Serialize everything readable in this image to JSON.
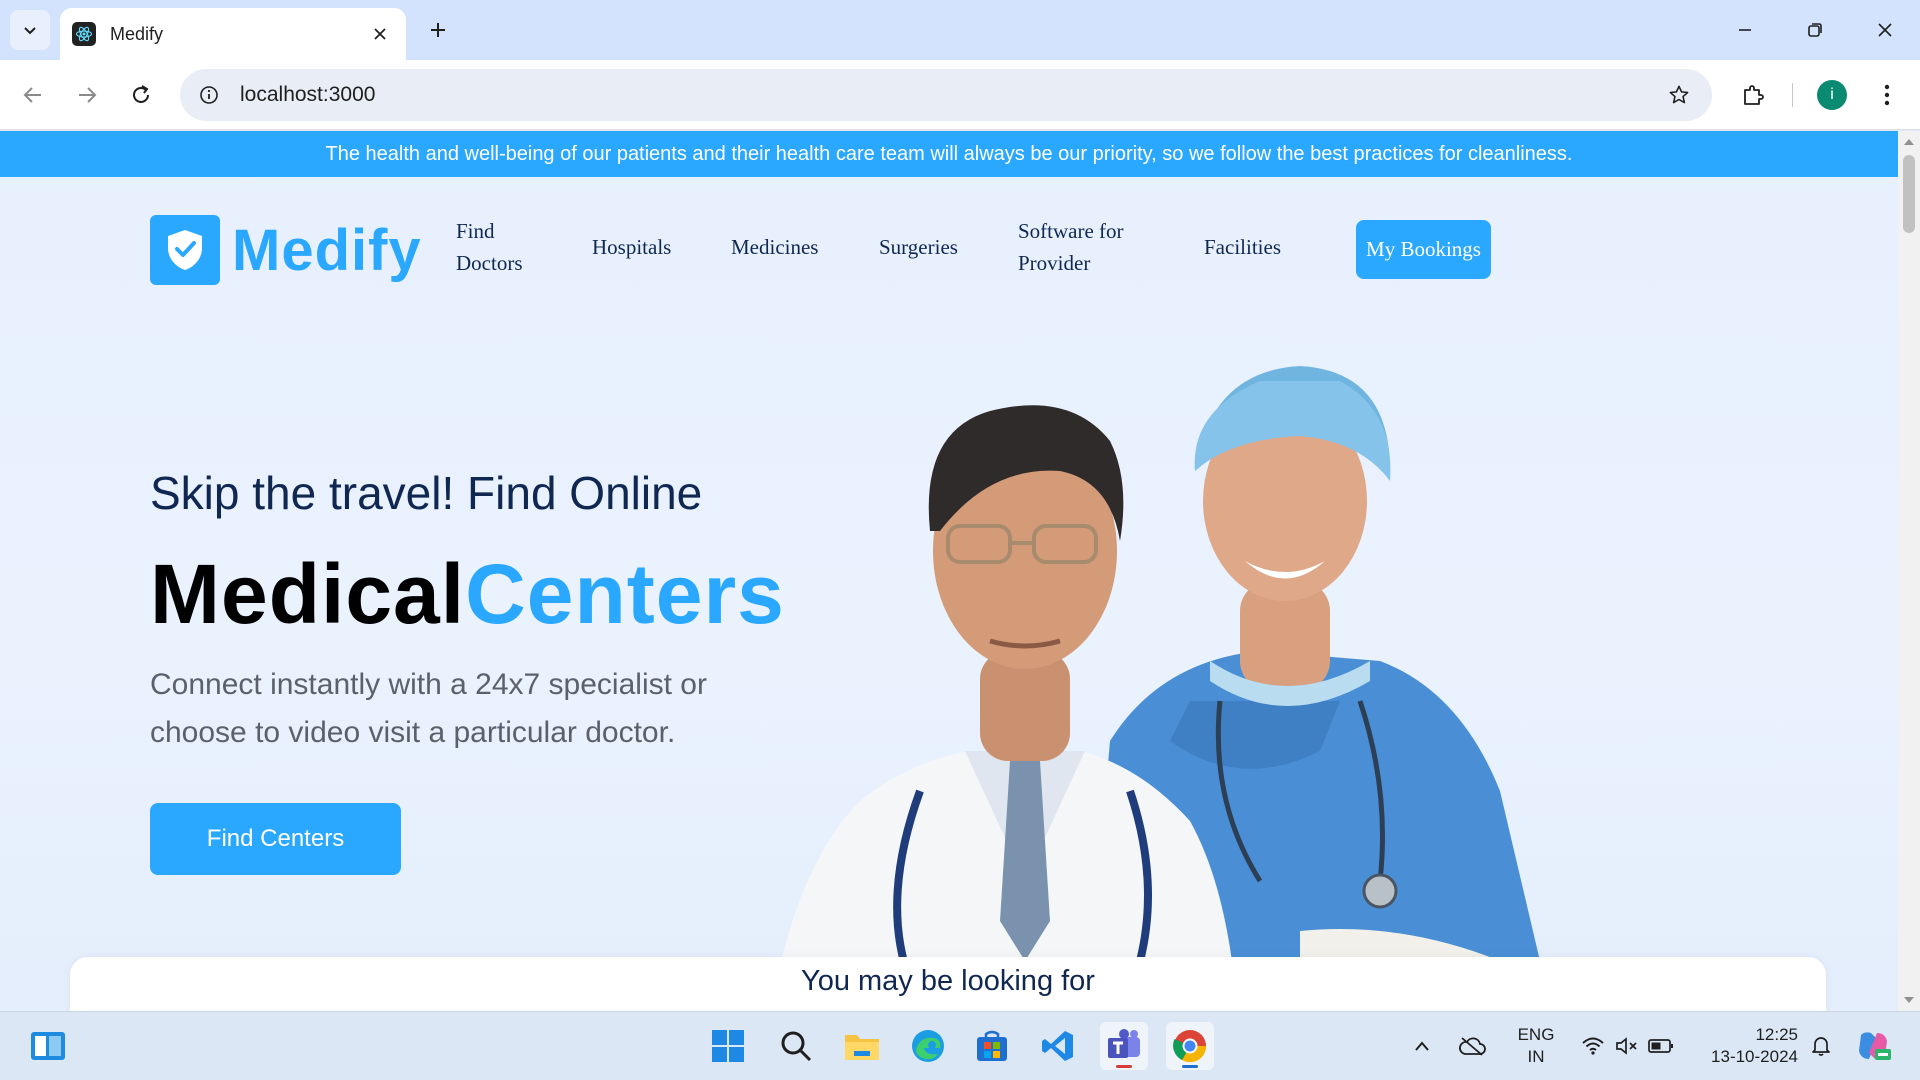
{
  "browser": {
    "tab_title": "Medify",
    "url": "localhost:3000",
    "profile_initial": "i"
  },
  "page": {
    "announcement": "The health and well-being of our patients and their health care team will always be our priority, so we follow the best practices for cleanliness.",
    "logo_text": "Medify",
    "nav": {
      "find_doctors_line1": "Find",
      "find_doctors_line2": "Doctors",
      "hospitals": "Hospitals",
      "medicines": "Medicines",
      "surgeries": "Surgeries",
      "software_line1": "Software for",
      "software_line2": "Provider",
      "facilities": "Facilities",
      "my_bookings": "My Bookings"
    },
    "hero": {
      "subtitle": "Skip the travel! Find Online",
      "title_part1": "Medical",
      "title_part2": "Centers",
      "description": "Connect instantly with a 24x7 specialist or choose to video visit a particular doctor.",
      "button": "Find Centers"
    },
    "section_heading": "You may be looking for",
    "brand_color": "#2aa7ff"
  },
  "taskbar": {
    "lang_line1": "ENG",
    "lang_line2": "IN",
    "time": "12:25",
    "date": "13-10-2024",
    "icons": [
      "widgets-icon",
      "windows-start-icon",
      "search-icon",
      "file-explorer-icon",
      "edge-icon",
      "store-icon",
      "vscode-icon",
      "teams-icon",
      "chrome-icon"
    ]
  }
}
